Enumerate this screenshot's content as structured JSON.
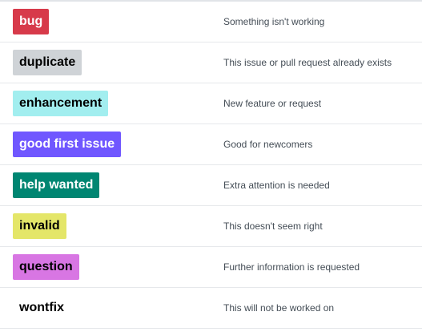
{
  "labels": [
    {
      "name": "bug",
      "description": "Something isn't working",
      "color": "#d73a4a",
      "text_color": "#ffffff"
    },
    {
      "name": "duplicate",
      "description": "This issue or pull request already exists",
      "color": "#cfd3d7",
      "text_color": "#000000"
    },
    {
      "name": "enhancement",
      "description": "New feature or request",
      "color": "#a2eeef",
      "text_color": "#000000"
    },
    {
      "name": "good first issue",
      "description": "Good for newcomers",
      "color": "#7057ff",
      "text_color": "#ffffff"
    },
    {
      "name": "help wanted",
      "description": "Extra attention is needed",
      "color": "#008672",
      "text_color": "#ffffff"
    },
    {
      "name": "invalid",
      "description": "This doesn't seem right",
      "color": "#e4e669",
      "text_color": "#000000"
    },
    {
      "name": "question",
      "description": "Further information is requested",
      "color": "#d876e3",
      "text_color": "#000000"
    },
    {
      "name": "wontfix",
      "description": "This will not be worked on",
      "color": "#ffffff",
      "text_color": "#000000"
    }
  ]
}
